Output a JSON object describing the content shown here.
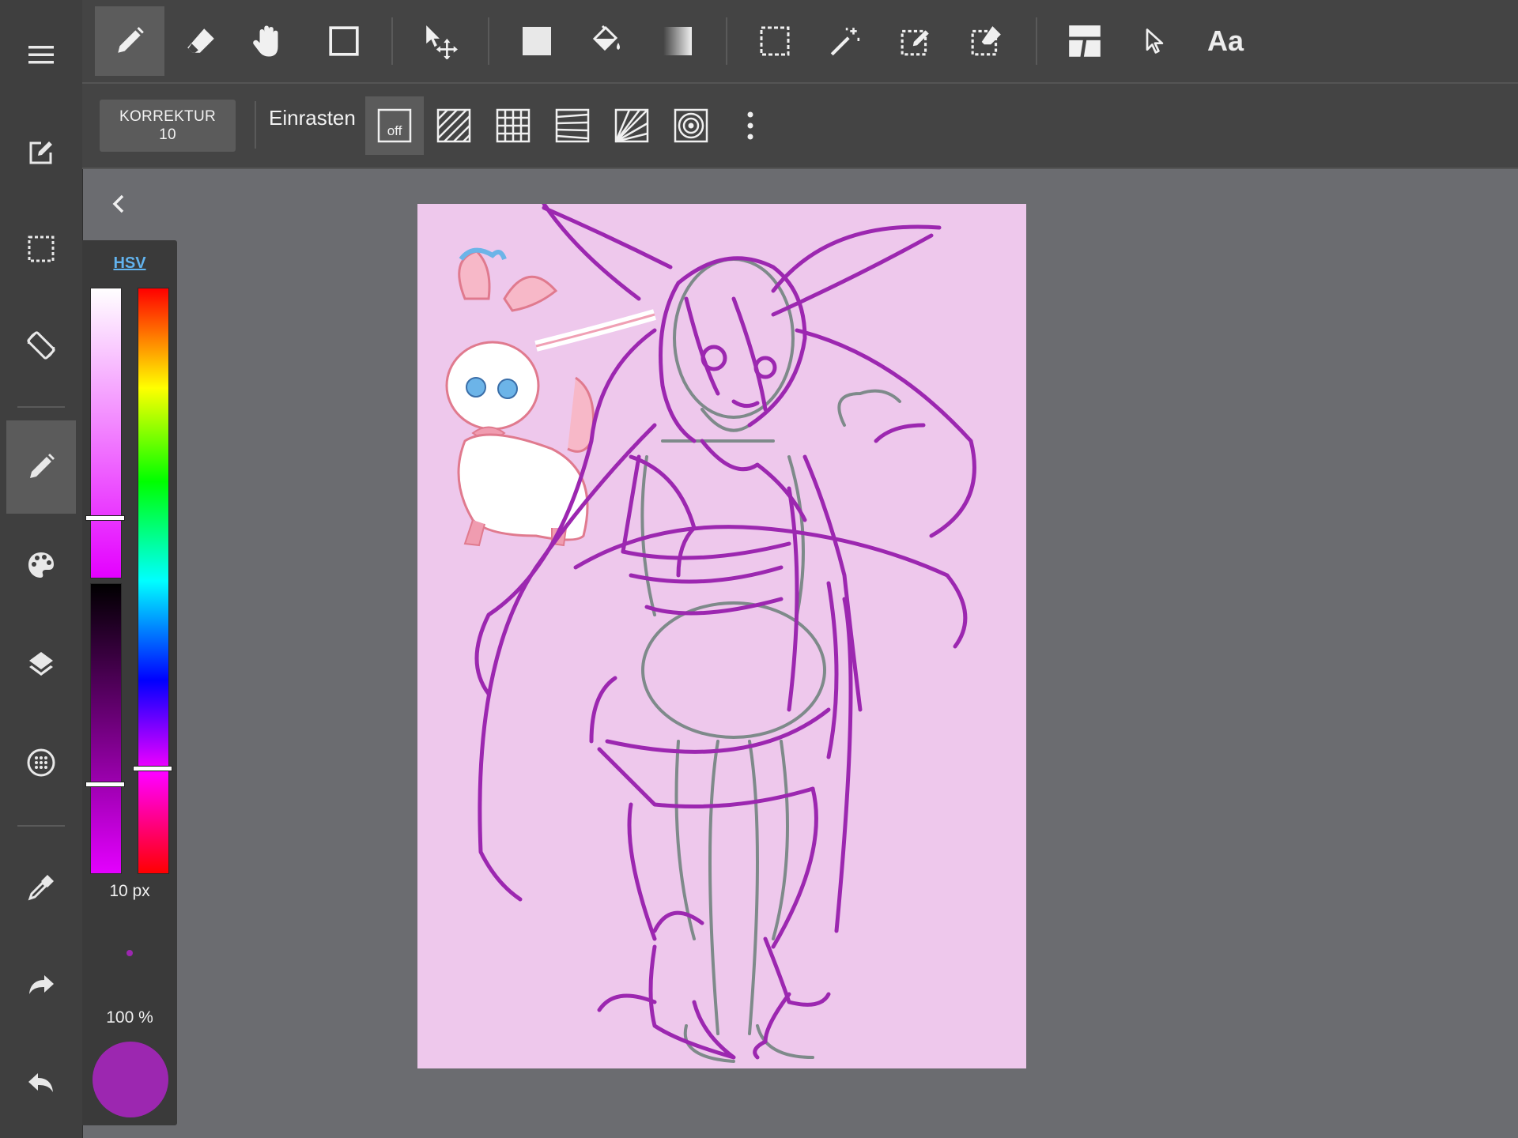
{
  "sidebar": {
    "items": [
      {
        "name": "menu",
        "icon": "menu-icon"
      },
      {
        "name": "new-canvas",
        "icon": "edit-square-icon"
      },
      {
        "name": "selection",
        "icon": "dashed-rectangle-icon"
      },
      {
        "name": "rotate-screen",
        "icon": "rotate-icon"
      },
      {
        "name": "brush",
        "icon": "pencil-icon",
        "active": true
      },
      {
        "name": "color",
        "icon": "palette-icon"
      },
      {
        "name": "layers",
        "icon": "layers-icon"
      },
      {
        "name": "materials",
        "icon": "dotted-circle-icon"
      },
      {
        "name": "eyedropper",
        "icon": "eyedropper-icon"
      },
      {
        "name": "redo",
        "icon": "redo-icon"
      },
      {
        "name": "undo",
        "icon": "undo-icon"
      }
    ]
  },
  "toolbar": {
    "tools": [
      {
        "name": "pen",
        "icon": "pencil-icon",
        "active": true
      },
      {
        "name": "eraser",
        "icon": "eraser-icon"
      },
      {
        "name": "hand",
        "icon": "hand-icon"
      },
      {
        "name": "shape",
        "icon": "square-outline-icon"
      },
      {
        "name": "move",
        "icon": "move-arrow-icon"
      },
      {
        "name": "fill-rect",
        "icon": "filled-square-icon"
      },
      {
        "name": "bucket",
        "icon": "paint-bucket-icon"
      },
      {
        "name": "gradient",
        "icon": "gradient-icon"
      },
      {
        "name": "select-rect",
        "icon": "dashed-rectangle-icon"
      },
      {
        "name": "magic-wand",
        "icon": "magic-wand-icon"
      },
      {
        "name": "select-pen",
        "icon": "select-pen-icon"
      },
      {
        "name": "select-eraser",
        "icon": "select-eraser-icon"
      },
      {
        "name": "frame-divider",
        "icon": "frame-divider-icon"
      },
      {
        "name": "operation",
        "icon": "pointer-icon"
      }
    ],
    "text_tool_label": "Aa"
  },
  "subbar": {
    "correction_label": "KORREKTUR",
    "correction_value": "10",
    "snap_label": "Einrasten",
    "snap_off_label": "off",
    "snap_options": [
      "parallel-lines-icon",
      "grid-icon",
      "perspective-lines-icon",
      "radial-lines-icon",
      "concentric-circles-icon",
      "more-vert-icon"
    ]
  },
  "color_panel": {
    "mode_label": "HSV",
    "saturation_level": 0.79,
    "value_level": 0.69,
    "hue_level": 0.82,
    "brush_size": "10 px",
    "opacity": "100 %",
    "color": "#9c27b0"
  },
  "canvas": {
    "background": "#eec8ec",
    "stroke_color": "#9c27b0",
    "sketch_color": "#7e8a8a"
  }
}
